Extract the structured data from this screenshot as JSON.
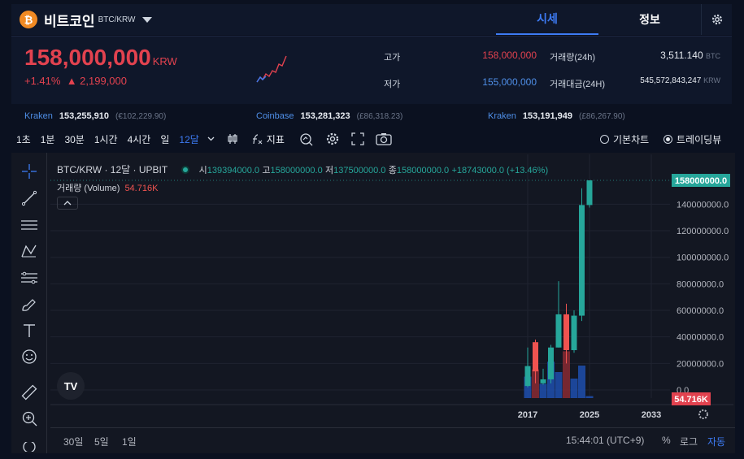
{
  "header": {
    "coin_symbol": "₿",
    "coin_name": "비트코인",
    "pair": "BTC/KRW",
    "tabs": [
      "시세",
      "정보"
    ],
    "active_tab": "시세"
  },
  "price": {
    "current": "158,000,000",
    "unit": "KRW",
    "change_pct": "+1.41%",
    "change_abs": "▲ 2,199,000",
    "high_label": "고가",
    "high": "158,000,000",
    "low_label": "저가",
    "low": "155,000,000",
    "volume_label": "거래량(24h)",
    "volume": "3,511.140",
    "volume_unit": "BTC",
    "amount_label": "거래대금(24H)",
    "amount": "545,572,843,247",
    "amount_unit": "KRW"
  },
  "exchanges": [
    {
      "name": "Kraken",
      "price": "153,255,910",
      "foreign": "(€102,229.90)"
    },
    {
      "name": "Coinbase",
      "price": "153,281,323",
      "foreign": "(£86,318.23)"
    },
    {
      "name": "Kraken",
      "price": "153,191,949",
      "foreign": "(£86,267.90)"
    }
  ],
  "toolbar": {
    "timeframes": [
      "1초",
      "1분",
      "30분",
      "1시간",
      "4시간",
      "일"
    ],
    "selected_timeframe": "12달",
    "indicator_label": "지표",
    "view_basic": "기본차트",
    "view_tv": "트레이딩뷰"
  },
  "legend": {
    "title": "BTC/KRW · 12달 · UPBIT",
    "open_label": "시",
    "open": "139394000.0",
    "high_label": "고",
    "high": "158000000.0",
    "low_label": "저",
    "low": "137500000.0",
    "close_label": "종",
    "close": "158000000.0",
    "change": "+18743000.0 (+13.46%)",
    "volume_label": "거래량 (Volume)",
    "volume_value": "54.716K"
  },
  "chart_data": {
    "type": "candlestick",
    "y_ticks": [
      "140000000.0",
      "120000000.0",
      "100000000.0",
      "80000000.0",
      "60000000.0",
      "40000000.0",
      "20000000.0",
      "0.0"
    ],
    "ylim": [
      0,
      158000000
    ],
    "x_ticks": [
      "2017",
      "2025",
      "2033"
    ],
    "last_price_label": "158000000.0",
    "last_volume_label": "54.716K",
    "candles": [
      {
        "year": 2017,
        "open": 18000000,
        "high": 32000000,
        "low": 2000000,
        "close": 3000000,
        "dir": "up"
      },
      {
        "year": 2018,
        "open": 36000000,
        "high": 38000000,
        "low": 5000000,
        "close": 14000000,
        "dir": "down"
      },
      {
        "year": 2019,
        "open": 5000000,
        "high": 16000000,
        "low": 4000000,
        "close": 8000000,
        "dir": "up"
      },
      {
        "year": 2020,
        "open": 8000000,
        "high": 34000000,
        "low": 5000000,
        "close": 32000000,
        "dir": "up"
      },
      {
        "year": 2021,
        "open": 32000000,
        "high": 82000000,
        "low": 32000000,
        "close": 57000000,
        "dir": "up"
      },
      {
        "year": 2022,
        "open": 57000000,
        "high": 65000000,
        "low": 20000000,
        "close": 30000000,
        "dir": "down"
      },
      {
        "year": 2023,
        "open": 30000000,
        "high": 60000000,
        "low": 28000000,
        "close": 56000000,
        "dir": "up"
      },
      {
        "year": 2024,
        "open": 56000000,
        "high": 152000000,
        "low": 52000000,
        "close": 139394000,
        "dir": "up"
      },
      {
        "year": 2025,
        "open": 139394000,
        "high": 158000000,
        "low": 137500000,
        "close": 158000000,
        "dir": "up"
      }
    ]
  },
  "bottom": {
    "ranges": [
      "30일",
      "5일",
      "1일"
    ],
    "time": "15:44:01 (UTC+9)",
    "percent": "%",
    "log": "로그",
    "auto": "자동"
  },
  "colors": {
    "up": "#26a69a",
    "down": "#ef5350",
    "accent": "#3d7bf4",
    "price_red": "#e2424f"
  }
}
